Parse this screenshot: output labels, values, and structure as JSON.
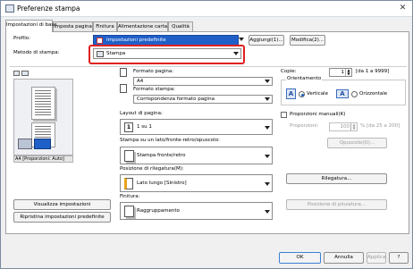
{
  "window": {
    "title": "Preferenze stampa"
  },
  "tabs": [
    {
      "label": "Impostazioni di base"
    },
    {
      "label": "Imposta pagina"
    },
    {
      "label": "Finitura"
    },
    {
      "label": "Alimentazione carta"
    },
    {
      "label": "Qualità"
    }
  ],
  "profile": {
    "label": "Profilo:",
    "value": "Impostazioni predefinite",
    "add_button": "Aggiungi(1)...",
    "edit_button": "Modifica(2)..."
  },
  "output_method": {
    "label": "Metodo di stampa:",
    "value": "Stampa"
  },
  "preview": {
    "caption": "A4 [Proporzioni: Auto]"
  },
  "page_size": {
    "label": "Formato pagina:",
    "value": "A4"
  },
  "output_size": {
    "label": "Formato stampa:",
    "value": "Corrispondenza formato pagina"
  },
  "copies": {
    "label": "Copie:",
    "value": "1",
    "range": "[da 1 a 9999]"
  },
  "orientation": {
    "label": "Orientamento",
    "portrait": "Verticale",
    "landscape": "Orizzontale"
  },
  "page_layout": {
    "label": "Layout di pagina:",
    "value": "1 su 1"
  },
  "manual_scaling": {
    "label": "Proporzioni manuali(K)",
    "scaling_label": "Proporzioni:",
    "scaling_value": "100",
    "scaling_range": "% [da 25 a 200]"
  },
  "print_style": {
    "label": "Stampa su un lato/fronte-retro/opuscolo:",
    "value": "Stampa fronte/retro",
    "booklet_button": "Opuscolo(O)..."
  },
  "binding": {
    "label": "Posizione di rilegatura(M):",
    "value": "Lato lungo [Sinistro]",
    "margin_button": "Rilegatura...",
    "position_button": "Posizione di pinzatura..."
  },
  "finishing": {
    "label": "Finitura:",
    "value": "Raggruppamento"
  },
  "left_buttons": {
    "view_settings": "Visualizza impostazioni",
    "restore_defaults": "Ripristina impostazioni predefinite"
  },
  "footer": {
    "ok": "OK",
    "cancel": "Annulla",
    "apply": "Applica",
    "help": "?"
  }
}
